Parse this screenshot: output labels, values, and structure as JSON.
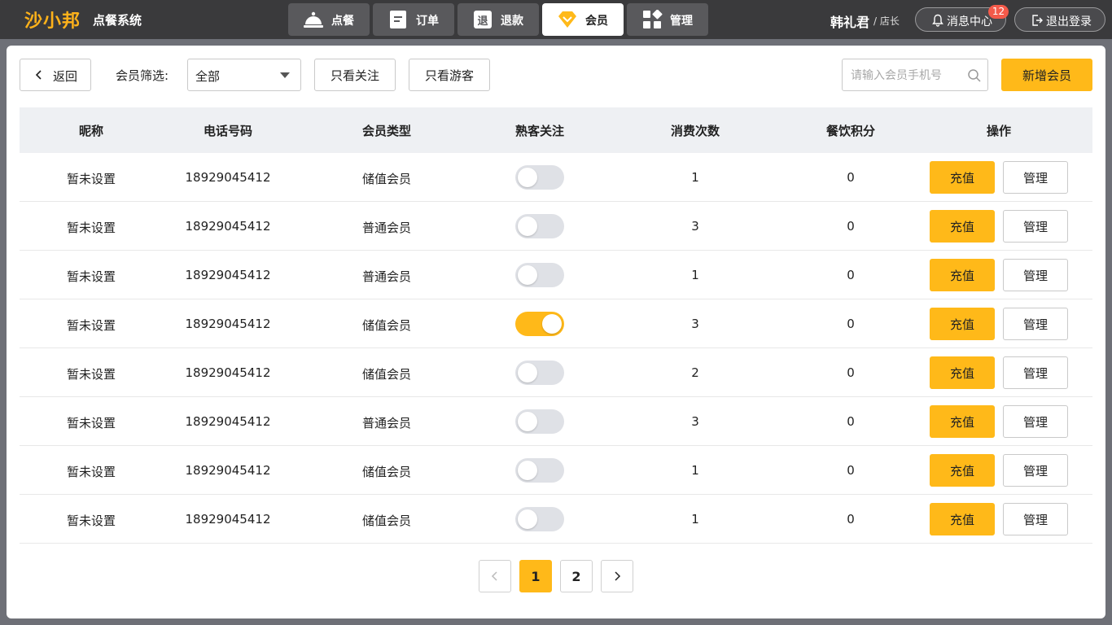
{
  "brand": {
    "logo": "沙小邦",
    "system": "点餐系统",
    "accent": "#ffb919"
  },
  "nav": [
    {
      "label": "点餐",
      "icon": "cloche-icon",
      "active": false
    },
    {
      "label": "订单",
      "icon": "clipboard-icon",
      "active": false
    },
    {
      "label": "退款",
      "icon": "refund-icon",
      "active": false,
      "icon_text": "退"
    },
    {
      "label": "会员",
      "icon": "diamond-icon",
      "active": true
    },
    {
      "label": "管理",
      "icon": "grid-icon",
      "active": false
    }
  ],
  "user": {
    "name": "韩礼君",
    "role": "/ 店长"
  },
  "header_actions": {
    "messages_label": "消息中心",
    "messages_count": "12",
    "logout_label": "退出登录"
  },
  "toolbar": {
    "back_label": "返回",
    "filter_label": "会员筛选:",
    "filter_value": "全部",
    "follow_only_label": "只看关注",
    "guest_only_label": "只看游客",
    "search_placeholder": "请输入会员手机号",
    "add_label": "新增会员"
  },
  "table": {
    "columns": [
      "昵称",
      "电话号码",
      "会员类型",
      "熟客关注",
      "消费次数",
      "餐饮积分",
      "操作"
    ],
    "recharge_label": "充值",
    "manage_label": "管理",
    "rows": [
      {
        "nickname": "暂未设置",
        "phone": "18929045412",
        "type": "储值会员",
        "followed": false,
        "visits": "1",
        "points": "0"
      },
      {
        "nickname": "暂未设置",
        "phone": "18929045412",
        "type": "普通会员",
        "followed": false,
        "visits": "3",
        "points": "0"
      },
      {
        "nickname": "暂未设置",
        "phone": "18929045412",
        "type": "普通会员",
        "followed": false,
        "visits": "1",
        "points": "0"
      },
      {
        "nickname": "暂未设置",
        "phone": "18929045412",
        "type": "储值会员",
        "followed": true,
        "visits": "3",
        "points": "0"
      },
      {
        "nickname": "暂未设置",
        "phone": "18929045412",
        "type": "储值会员",
        "followed": false,
        "visits": "2",
        "points": "0"
      },
      {
        "nickname": "暂未设置",
        "phone": "18929045412",
        "type": "普通会员",
        "followed": false,
        "visits": "3",
        "points": "0"
      },
      {
        "nickname": "暂未设置",
        "phone": "18929045412",
        "type": "储值会员",
        "followed": false,
        "visits": "1",
        "points": "0"
      },
      {
        "nickname": "暂未设置",
        "phone": "18929045412",
        "type": "储值会员",
        "followed": false,
        "visits": "1",
        "points": "0"
      }
    ]
  },
  "pagination": {
    "pages": [
      "1",
      "2"
    ],
    "current": "1"
  }
}
